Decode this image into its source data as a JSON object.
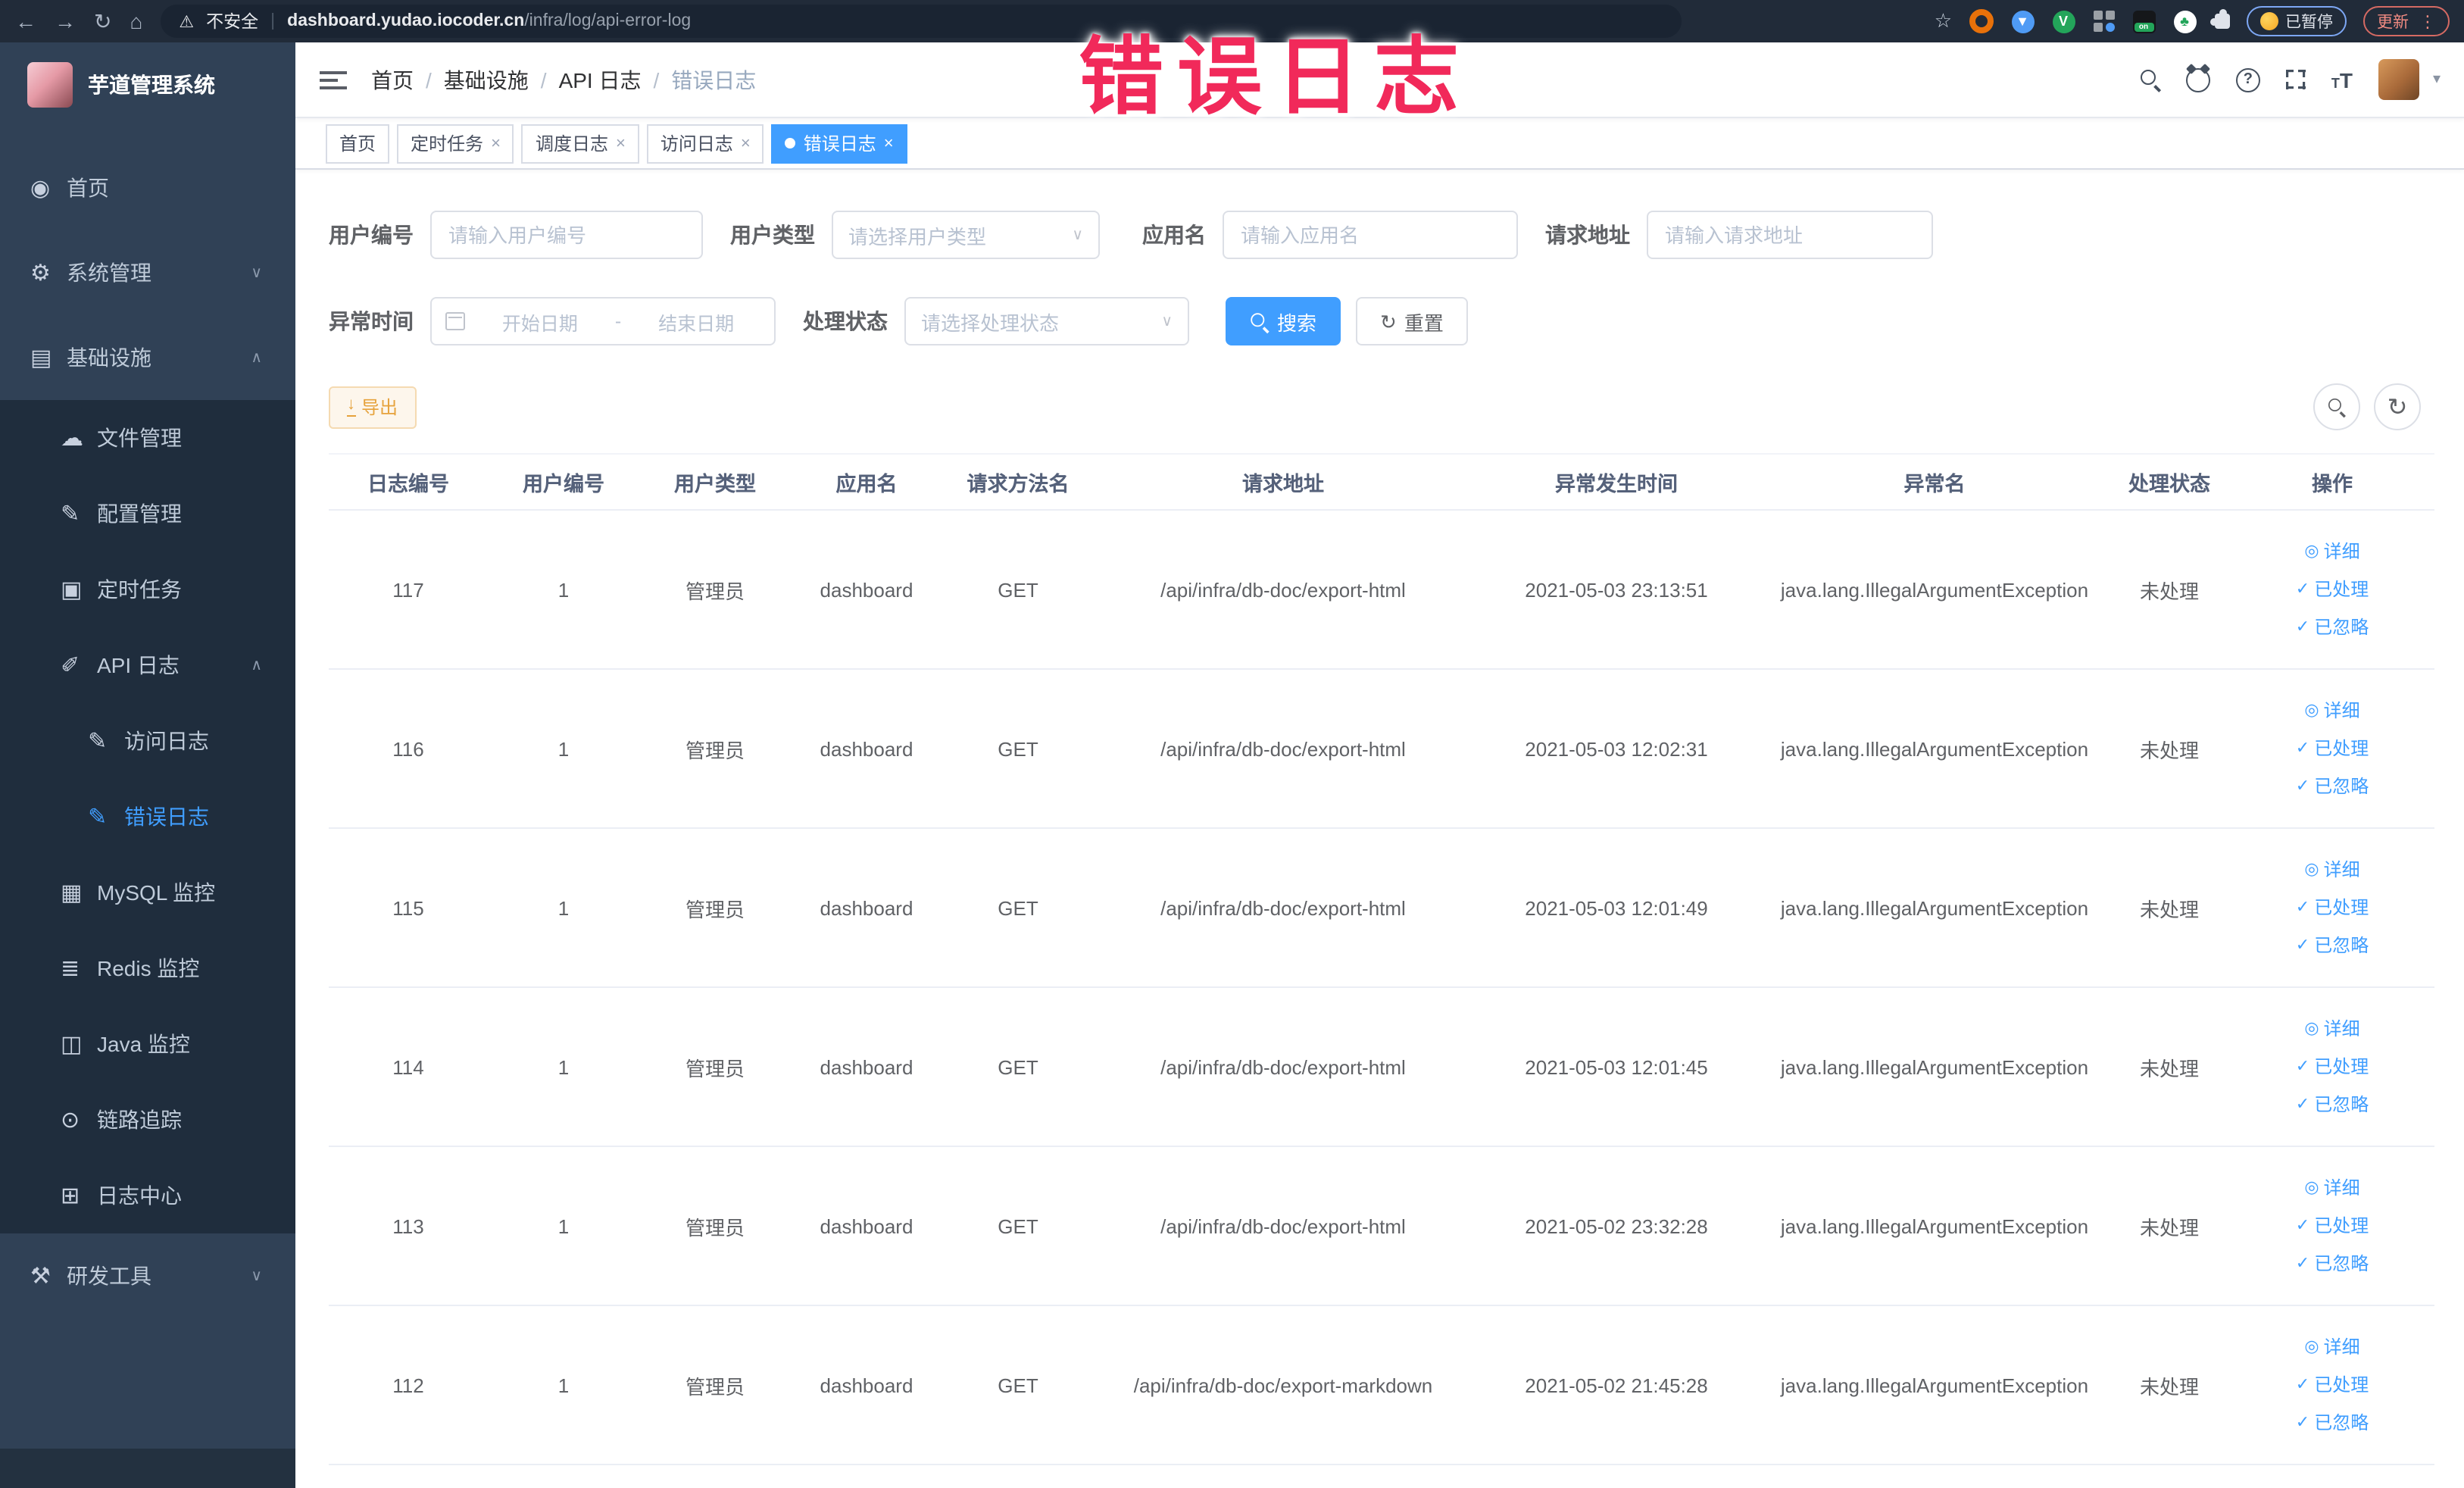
{
  "annotation": "错误日志",
  "colors": {
    "accent": "#409eff",
    "warning": "#e6a23c",
    "annotation_pink": "#f1295a",
    "sidebar_bg": "#304156",
    "sidebar_submenu_bg": "#1f2d3d",
    "browser_bar_bg": "#212b39"
  },
  "browser": {
    "security_text": "不安全",
    "url_domain": "dashboard.yudao.iocoder.cn",
    "url_path": "/infra/log/api-error-log",
    "paused_label": "已暂停",
    "update_label": "更新",
    "extensions": [
      {
        "name": "orange-ring-extension-icon",
        "kind": "ring",
        "color": "#e8710a"
      },
      {
        "name": "blue-shield-extension-icon",
        "kind": "round",
        "color": "#4f9bf5",
        "glyph": "▼"
      },
      {
        "name": "green-v-extension-icon",
        "kind": "round",
        "color": "#23a55a",
        "glyph": "V"
      },
      {
        "name": "grid-extension-icon",
        "kind": "grid"
      },
      {
        "name": "on-toggle-extension-icon",
        "kind": "toggle",
        "label": "on"
      },
      {
        "name": "green-leaf-extension-icon",
        "kind": "round",
        "color": "#ffffff",
        "glyph": "♣",
        "fg": "#23a55a"
      },
      {
        "name": "puzzle-extension-icon",
        "kind": "puzzle"
      }
    ]
  },
  "sidebar": {
    "logo_title": "芋道管理系统",
    "items": [
      {
        "key": "home",
        "label": "首页",
        "icon": "dashboard-icon",
        "level": 0
      },
      {
        "key": "system",
        "label": "系统管理",
        "icon": "gear-icon",
        "level": 0,
        "arrow": "down"
      },
      {
        "key": "infra",
        "label": "基础设施",
        "icon": "infra-icon",
        "level": 0,
        "arrow": "up"
      },
      {
        "key": "file",
        "label": "文件管理",
        "icon": "file-icon",
        "level": 1,
        "sub": true
      },
      {
        "key": "config",
        "label": "配置管理",
        "icon": "config-icon",
        "level": 1,
        "sub": true
      },
      {
        "key": "job",
        "label": "定时任务",
        "icon": "job-icon",
        "level": 1,
        "sub": true
      },
      {
        "key": "api-log",
        "label": "API 日志",
        "icon": "api-log-icon",
        "level": 1,
        "sub": true,
        "arrow": "up"
      },
      {
        "key": "access-log",
        "label": "访问日志",
        "icon": "access-log-icon",
        "level": 2,
        "sub": true
      },
      {
        "key": "error-log",
        "label": "错误日志",
        "icon": "error-log-icon",
        "level": 2,
        "sub": true,
        "active": true
      },
      {
        "key": "mysql",
        "label": "MySQL 监控",
        "icon": "mysql-icon",
        "level": 1,
        "sub": true
      },
      {
        "key": "redis",
        "label": "Redis 监控",
        "icon": "redis-icon",
        "level": 1,
        "sub": true
      },
      {
        "key": "java",
        "label": "Java 监控",
        "icon": "java-icon",
        "level": 1,
        "sub": true
      },
      {
        "key": "trace",
        "label": "链路追踪",
        "icon": "trace-icon",
        "level": 1,
        "sub": true
      },
      {
        "key": "log-center",
        "label": "日志中心",
        "icon": "log-center-icon",
        "level": 1,
        "sub": true
      },
      {
        "key": "devtools",
        "label": "研发工具",
        "icon": "devtools-icon",
        "level": 0,
        "arrow": "down"
      }
    ]
  },
  "icons": {
    "dashboard-icon": "◉",
    "gear-icon": "⚙",
    "infra-icon": "▤",
    "file-icon": "☁",
    "config-icon": "✎",
    "job-icon": "▣",
    "api-log-icon": "✐",
    "access-log-icon": "✎",
    "error-log-icon": "✎",
    "mysql-icon": "▦",
    "redis-icon": "≣",
    "java-icon": "◫",
    "trace-icon": "⊙",
    "log-center-icon": "⊞",
    "devtools-icon": "⚒",
    "back-icon": "←",
    "forward-icon": "→",
    "reload-icon": "↻",
    "home-icon": "⌂",
    "warning-icon": "⚠",
    "bookmark-star-icon": "☆",
    "kebab-menu-icon": "⋮",
    "refresh-icon": "↻",
    "download-icon": "↓",
    "view-icon": "◎",
    "check-icon": "✓",
    "caret-down-icon": "▾",
    "chevron-up": "∧",
    "chevron-down": "∨"
  },
  "breadcrumb": [
    "首页",
    "基础设施",
    "API 日志",
    "错误日志"
  ],
  "tabs": [
    {
      "label": "首页",
      "closable": false,
      "active": false
    },
    {
      "label": "定时任务",
      "closable": true,
      "active": false
    },
    {
      "label": "调度日志",
      "closable": true,
      "active": false
    },
    {
      "label": "访问日志",
      "closable": true,
      "active": false
    },
    {
      "label": "错误日志",
      "closable": true,
      "active": true
    }
  ],
  "filters": {
    "user_id": {
      "label": "用户编号",
      "placeholder": "请输入用户编号"
    },
    "user_type": {
      "label": "用户类型",
      "placeholder": "请选择用户类型"
    },
    "app_name": {
      "label": "应用名",
      "placeholder": "请输入应用名"
    },
    "req_url": {
      "label": "请求地址",
      "placeholder": "请输入请求地址"
    },
    "time": {
      "label": "异常时间",
      "start_placeholder": "开始日期",
      "separator": "-",
      "end_placeholder": "结束日期"
    },
    "status": {
      "label": "处理状态",
      "placeholder": "请选择处理状态"
    },
    "search_label": "搜索",
    "reset_label": "重置"
  },
  "toolbar": {
    "export_label": "导出"
  },
  "table": {
    "columns": [
      "日志编号",
      "用户编号",
      "用户类型",
      "应用名",
      "请求方法名",
      "请求地址",
      "异常发生时间",
      "异常名",
      "处理状态",
      "操作"
    ],
    "actions": [
      "详细",
      "已处理",
      "已忽略"
    ],
    "rows": [
      {
        "id": "117",
        "user": "1",
        "type": "管理员",
        "app": "dashboard",
        "method": "GET",
        "url": "/api/infra/db-doc/export-html",
        "time": "2021-05-03 23:13:51",
        "exception": "java.lang.IllegalArgumentException",
        "status": "未处理"
      },
      {
        "id": "116",
        "user": "1",
        "type": "管理员",
        "app": "dashboard",
        "method": "GET",
        "url": "/api/infra/db-doc/export-html",
        "time": "2021-05-03 12:02:31",
        "exception": "java.lang.IllegalArgumentException",
        "status": "未处理"
      },
      {
        "id": "115",
        "user": "1",
        "type": "管理员",
        "app": "dashboard",
        "method": "GET",
        "url": "/api/infra/db-doc/export-html",
        "time": "2021-05-03 12:01:49",
        "exception": "java.lang.IllegalArgumentException",
        "status": "未处理"
      },
      {
        "id": "114",
        "user": "1",
        "type": "管理员",
        "app": "dashboard",
        "method": "GET",
        "url": "/api/infra/db-doc/export-html",
        "time": "2021-05-03 12:01:45",
        "exception": "java.lang.IllegalArgumentException",
        "status": "未处理"
      },
      {
        "id": "113",
        "user": "1",
        "type": "管理员",
        "app": "dashboard",
        "method": "GET",
        "url": "/api/infra/db-doc/export-html",
        "time": "2021-05-02 23:32:28",
        "exception": "java.lang.IllegalArgumentException",
        "status": "未处理"
      },
      {
        "id": "112",
        "user": "1",
        "type": "管理员",
        "app": "dashboard",
        "method": "GET",
        "url": "/api/infra/db-doc/export-markdown",
        "time": "2021-05-02 21:45:28",
        "exception": "java.lang.IllegalArgumentException",
        "status": "未处理"
      }
    ]
  }
}
